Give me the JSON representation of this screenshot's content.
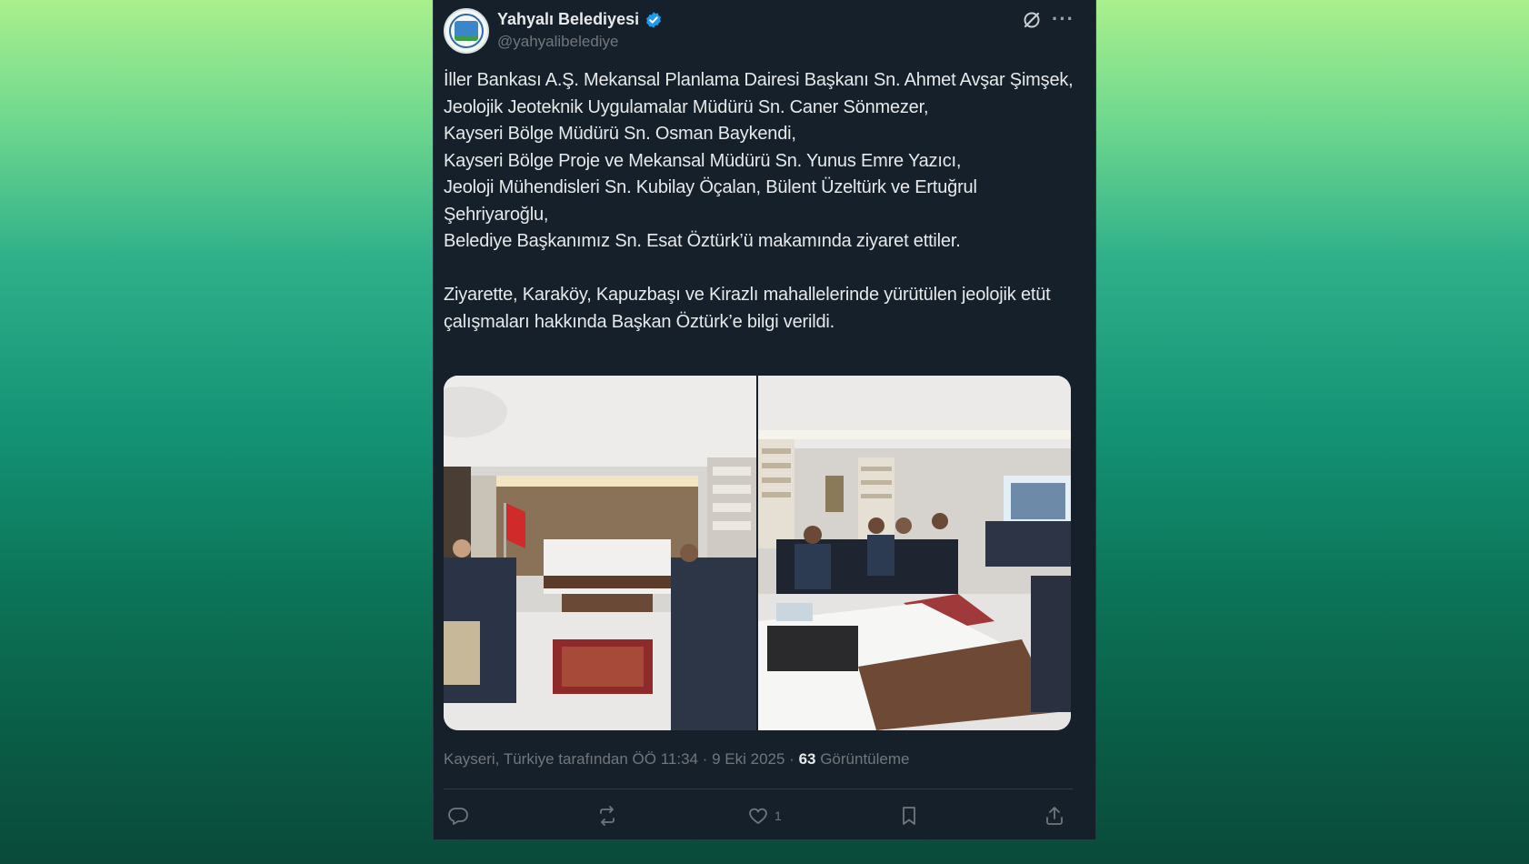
{
  "tweet": {
    "display_name": "Yahyalı Belediyesi",
    "handle": "@yahyalibelediye",
    "verified_icon": "verified-badge-icon",
    "text": "İller Bankası A.Ş. Mekansal Planlama Dairesi Başkanı Sn. Ahmet Avşar Şimşek,\nJeolojik Jeoteknik Uygulamalar Müdürü Sn. Caner Sönmezer,\nKayseri Bölge Müdürü Sn. Osman Baykendi,\nKayseri Bölge Proje ve Mekansal Müdürü Sn. Yunus Emre Yazıcı,\nJeoloji Mühendisleri Sn. Kubilay Öçalan, Bülent Üzeltürk ve Ertuğrul Şehriyaroğlu,\nBelediye Başkanımız Sn. Esat Öztürk’ü makamında ziyaret ettiler.\n\nZiyarette, Karaköy, Kapuzbaşı ve Kirazlı mahallelerinde yürütülen jeolojik etüt çalışmaları hakkında Başkan Öztürk’e bilgi verildi.",
    "meta_prefix": "Kayseri, Türkiye tarafından ÖÖ 11:34 · 9 Eki 2025 · ",
    "views_count": "63",
    "views_label": " Görüntüleme",
    "likes_count": "1"
  },
  "icons": {
    "grok": "grok-icon",
    "more": "more-options-icon",
    "reply": "reply-icon",
    "retweet": "retweet-icon",
    "like": "heart-icon",
    "bookmark": "bookmark-icon",
    "share": "share-icon"
  },
  "colors": {
    "background_top": "#aaf08d",
    "background_bottom": "#0a4a3a",
    "card": "#15202b",
    "text": "#e7e9ea",
    "muted": "#71767b",
    "verified": "#1d9bf0"
  }
}
